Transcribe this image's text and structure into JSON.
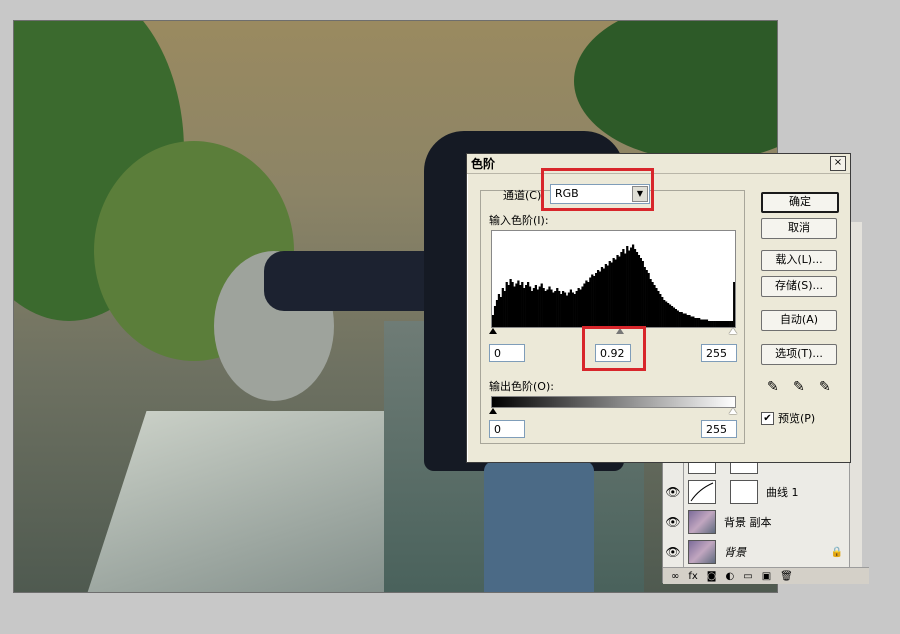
{
  "dialog": {
    "title": "色阶",
    "close": "×",
    "channel_label": "通道(C):",
    "channel_value": "RGB",
    "input_levels_label": "输入色阶(I):",
    "input_black": "0",
    "input_gamma": "0.92",
    "input_white": "255",
    "output_levels_label": "输出色阶(O):",
    "output_black": "0",
    "output_white": "255",
    "buttons": {
      "ok": "确定",
      "cancel": "取消",
      "load": "载入(L)...",
      "save": "存储(S)...",
      "auto": "自动(A)",
      "options": "选项(T)..."
    },
    "preview_label": "预览(P)",
    "preview_checked": "✔"
  },
  "layers": {
    "rows": [
      {
        "name": "曲线 1",
        "visible_icon": "👁"
      },
      {
        "name": "背景 副本",
        "visible_icon": "👁"
      },
      {
        "name": "背景",
        "visible_icon": "👁",
        "lock_icon": "🔒"
      }
    ],
    "footer_icons": [
      "link-icon",
      "fx-icon",
      "mask-icon",
      "adjustment-icon",
      "folder-icon",
      "new-layer-icon",
      "trash-icon"
    ]
  },
  "histogram": {
    "heights": [
      8,
      14,
      18,
      22,
      20,
      26,
      24,
      30,
      28,
      32,
      30,
      27,
      29,
      31,
      28,
      30,
      26,
      28,
      30,
      27,
      24,
      26,
      28,
      25,
      27,
      29,
      26,
      24,
      25,
      27,
      25,
      23,
      24,
      26,
      24,
      22,
      24,
      23,
      21,
      23,
      25,
      23,
      22,
      24,
      26,
      25,
      27,
      29,
      31,
      30,
      33,
      35,
      34,
      36,
      38,
      37,
      40,
      39,
      42,
      41,
      44,
      43,
      46,
      45,
      48,
      47,
      50,
      52,
      49,
      54,
      51,
      53,
      55,
      52,
      50,
      48,
      46,
      44,
      40,
      38,
      36,
      32,
      30,
      28,
      26,
      24,
      22,
      20,
      18,
      17,
      16,
      15,
      14,
      13,
      12,
      11,
      10,
      10,
      9,
      9,
      8,
      8,
      7,
      7,
      6,
      6,
      6,
      5,
      5,
      5,
      5,
      4,
      4,
      4,
      4,
      4,
      4,
      4,
      4,
      4,
      4,
      4,
      4,
      4,
      30
    ]
  },
  "colors": {
    "highlight": "#d8262b",
    "dialog_bg": "#ece9d8"
  }
}
